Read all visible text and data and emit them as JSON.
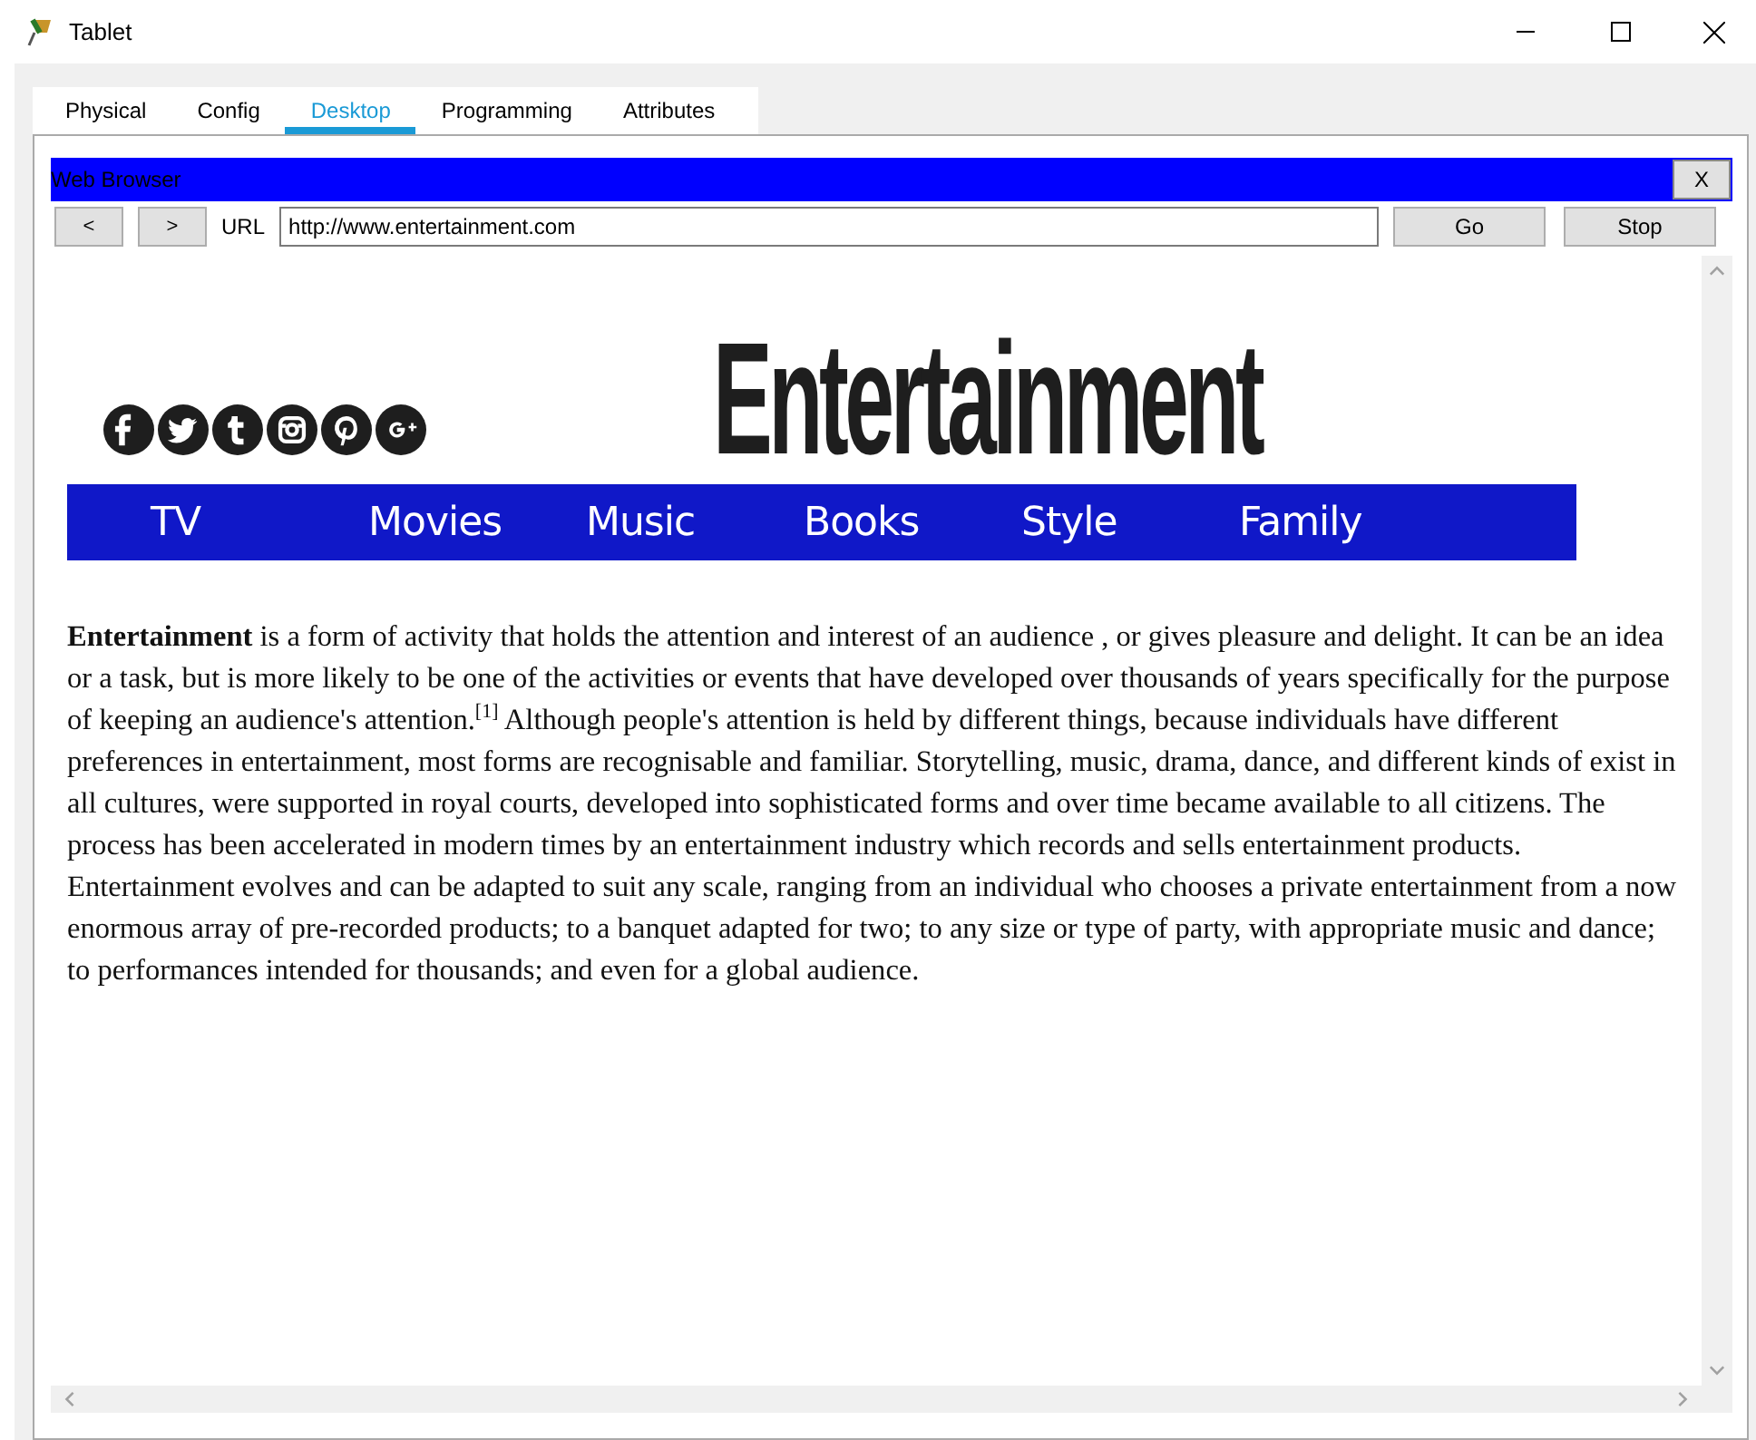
{
  "window": {
    "title": "Tablet"
  },
  "tabs": [
    {
      "label": "Physical",
      "selected": false
    },
    {
      "label": "Config",
      "selected": false
    },
    {
      "label": "Desktop",
      "selected": true
    },
    {
      "label": "Programming",
      "selected": false
    },
    {
      "label": "Attributes",
      "selected": false
    }
  ],
  "browser": {
    "title": "Web Browser",
    "close": "X",
    "back": "<",
    "forward": ">",
    "url_label": "URL",
    "url": "http://www.entertainment.com",
    "go": "Go",
    "stop": "Stop"
  },
  "page": {
    "logo": "Entertainment",
    "nav": [
      "TV",
      "Movies",
      "Music",
      "Books",
      "Style",
      "Family"
    ],
    "paragraph": "**Entertainment** is a form of activity that holds the attention and interest of an audience , or gives pleasure and delight. It can be an idea or a task, but is more likely to be one of the activities or events that have developed over thousands of years specifically for the purpose of keeping an audience's attention.$^{[1]}$ Although people's attention is held by different things, because individuals have different preferences in entertainment, most forms are recognisable and familiar. Storytelling, music, drama, dance, and different kinds of exist in all cultures, were supported in royal courts, developed into sophisticated forms and over time became available to all citizens. The process has been accelerated in modern times by an entertainment industry which records and sells entertainment products. Entertainment evolves and can be adapted to suit any scale, ranging from an individual who chooses a private entertainment from a now enormous array of pre-recorded products; to a banquet adapted for two; to any size or type of party, with appropriate music and dance; to performances intended for thousands; and even for a global audience."
  }
}
